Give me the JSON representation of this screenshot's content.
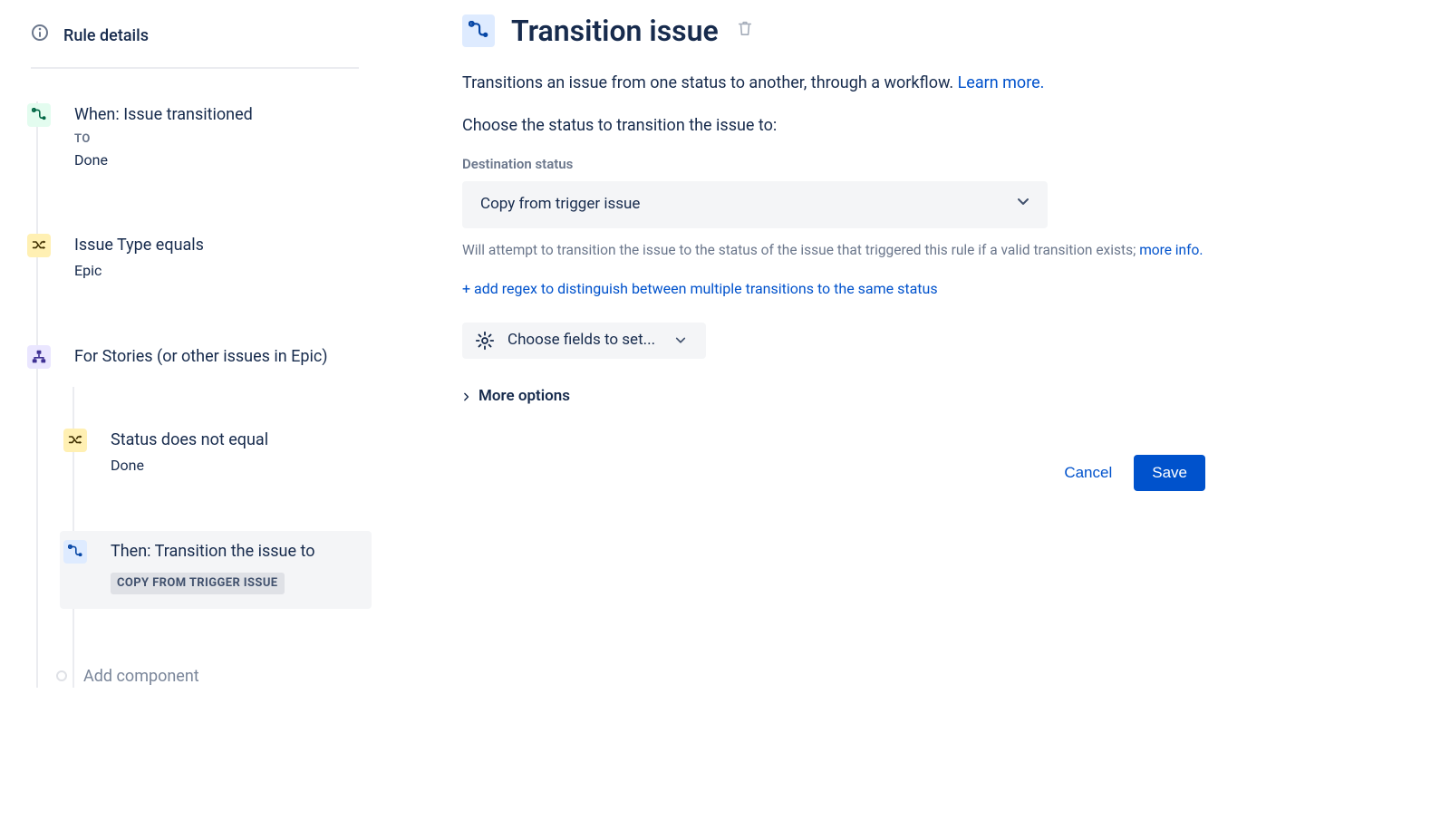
{
  "sidebar": {
    "header": "Rule details",
    "steps": {
      "trigger": {
        "title": "When: Issue transitioned",
        "sublabel": "TO",
        "value": "Done"
      },
      "cond1": {
        "title": "Issue Type equals",
        "value": "Epic"
      },
      "branch": {
        "title": "For Stories (or other issues in Epic)"
      },
      "cond2": {
        "title": "Status does not equal",
        "value": "Done"
      },
      "action": {
        "title": "Then: Transition the issue to",
        "chip": "Copy from trigger issue"
      }
    },
    "add_component": "Add component"
  },
  "panel": {
    "title": "Transition issue",
    "description": "Transitions an issue from one status to another, through a workflow. ",
    "learn_more": "Learn more.",
    "choose_label": "Choose the status to transition the issue to:",
    "dest_label": "Destination status",
    "dest_value": "Copy from trigger issue",
    "help1": "Will attempt to transition the issue to the status of the issue that triggered this rule if a valid transition exists; ",
    "more_info": "more info.",
    "add_regex": "+ add regex to distinguish between multiple transitions to the same status",
    "choose_fields": "Choose fields to set...",
    "more_options": "More options",
    "cancel": "Cancel",
    "save": "Save"
  }
}
